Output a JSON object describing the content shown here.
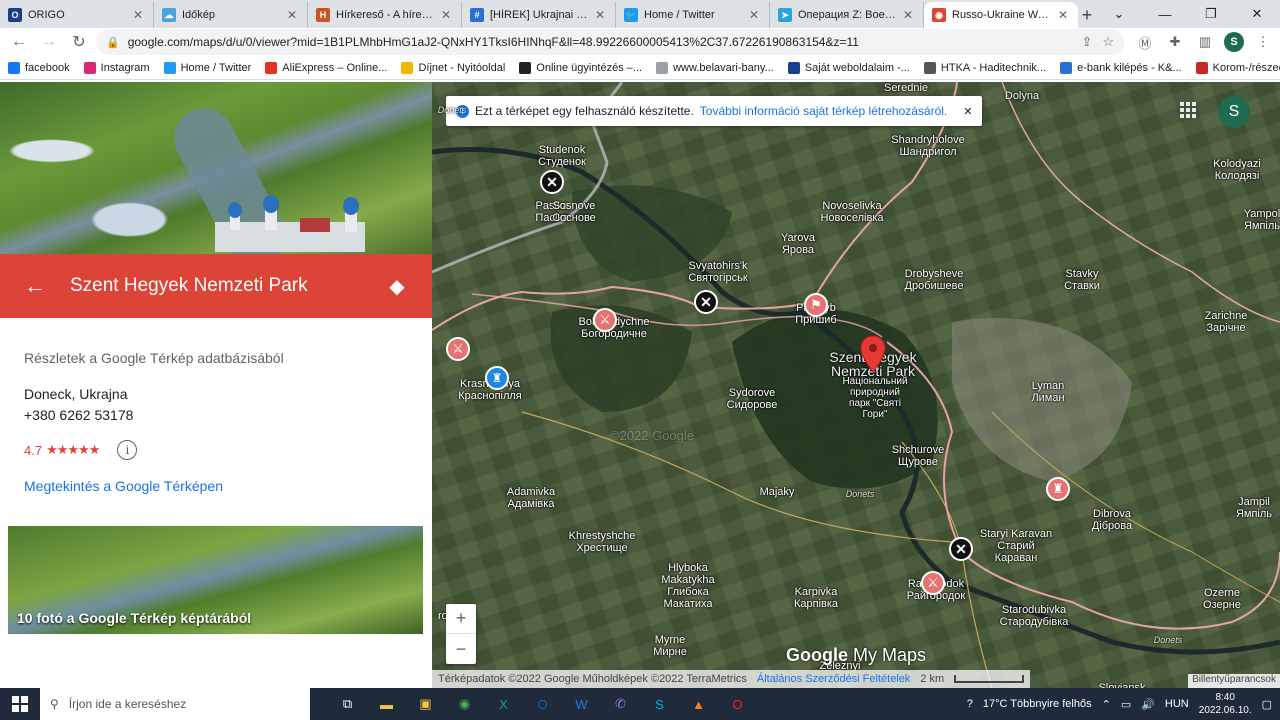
{
  "tabs": [
    {
      "title": "ORIGO",
      "color": "#1a3f8f",
      "glyph": "O"
    },
    {
      "title": "Időkép",
      "color": "#4aa3df",
      "glyph": "☁"
    },
    {
      "title": "Hírkereső - A hírek itt k",
      "color": "#c9541d",
      "glyph": "H"
    },
    {
      "title": "[HÍREK] Ukrajnai fegyve",
      "color": "#2a6fd1",
      "glyph": "#"
    },
    {
      "title": "Home / Twitter",
      "color": "#1d9bf0",
      "glyph": "🐦"
    },
    {
      "title": "Операция Z: Военкорр",
      "color": "#2aa3de",
      "glyph": "➤"
    },
    {
      "title": "Russo-Ukraine War – G",
      "color": "#db4437",
      "glyph": "◉",
      "active": true
    }
  ],
  "address": {
    "url": "google.com/maps/d/u/0/viewer?mid=1B1PLMhbHmG1aJ2-QNxHY1TksI6HINhqF&ll=48.99226600005413%2C37.67226190863154&z=11",
    "profile_letter": "S"
  },
  "bookmarks": [
    {
      "label": "facebook",
      "color": "#1877f2"
    },
    {
      "label": "Instagram",
      "color": "#d62976"
    },
    {
      "label": "Home / Twitter",
      "color": "#1d9bf0"
    },
    {
      "label": "AliExpress – Online...",
      "color": "#e43225"
    },
    {
      "label": "Díjnet - Nyitóoldal",
      "color": "#f2b600"
    },
    {
      "label": "Online ügyintézés –...",
      "color": "#222222"
    },
    {
      "label": "www.belavari-bany...",
      "color": "#9aa0a6"
    },
    {
      "label": "Saját weboldalaim -...",
      "color": "#1a3f8f"
    },
    {
      "label": "HTKA - Haditechnik...",
      "color": "#555555"
    },
    {
      "label": "e-bank kilépés - K&...",
      "color": "#2a6fd1"
    },
    {
      "label": "Korom-/részecskes...",
      "color": "#c62828"
    }
  ],
  "place": {
    "name": "Szent Hegyek Nemzeti Park",
    "source": "Részletek a Google Térkép adatbázisából",
    "address_line": "Doneck, Ukrajna",
    "phone": "+380 6262 53178",
    "rating": "4.7",
    "rating_value": 4.7,
    "stars": "★★★★★",
    "view_link": "Megtekintés a Google Térképen",
    "photos_caption": "10 fotó a Google Térkép képtárából"
  },
  "map": {
    "banner_text": "Ezt a térképet egy felhasználó készítette.",
    "banner_link": "További információ saját térkép létrehozásáról.",
    "avatar_letter": "S",
    "zoom_in": "+",
    "zoom_out": "−",
    "brand": "Google",
    "brand_suffix": "My Maps",
    "attribution": "Térképadatok ©2022 Google Műholdképek ©2022 TerraMetrics",
    "terms": "Általános Szerződési Feltételek",
    "scale": "2 km",
    "keyboard": "Billentyűparancsok",
    "labels": [
      {
        "id": "dolyna",
        "text": "Dolyna"
      },
      {
        "id": "serednie",
        "text": "Serednie"
      },
      {
        "id": "studenok",
        "text": "Studenok\nСтуденок"
      },
      {
        "id": "pasika",
        "text": "Pasika\nПасіка"
      },
      {
        "id": "shandryholove",
        "text": "Shandryholove\nШандригол"
      },
      {
        "id": "kolodyazi",
        "text": "Kolodyazi\nКолодязі"
      },
      {
        "id": "sosnove",
        "text": "Sosnove\nСоснове"
      },
      {
        "id": "novoselivka",
        "text": "Novoselivka\nНовоселівка"
      },
      {
        "id": "yarova",
        "text": "Yarova\nЯрова"
      },
      {
        "id": "yampil_top",
        "text": "Yampol\nЯмпіль"
      },
      {
        "id": "svyatohirsk",
        "text": "Svyatohirs'k\nСвятогірськ"
      },
      {
        "id": "drobysheve",
        "text": "Drobysheve\nДробишеве"
      },
      {
        "id": "stavky",
        "text": "Stavky\nСтавки"
      },
      {
        "id": "bohorodychne",
        "text": "Bohorodychne\nБогородичне"
      },
      {
        "id": "pryshyb",
        "text": "Pryshyb\nПришиб"
      },
      {
        "id": "zarichne",
        "text": "Zarichne\nЗарічне"
      },
      {
        "id": "krasnopillia",
        "text": "Krasnopillya\nКраснопілля"
      },
      {
        "id": "sydorove",
        "text": "Sydorove\nСидорове"
      },
      {
        "id": "nationalpark",
        "text": "Szent Hegyek\nNemzeti Park"
      },
      {
        "id": "parkua",
        "text": "Національний\nприродний\nпарк \"Святі\nГори\""
      },
      {
        "id": "lyman",
        "text": "Lyman\nЛиман"
      },
      {
        "id": "shchurove",
        "text": "Shchurove\nЩурове"
      },
      {
        "id": "majaky",
        "text": "Majaky"
      },
      {
        "id": "adamivka",
        "text": "Adamivka\nАдамівка"
      },
      {
        "id": "yampil",
        "text": "Jampil\nЯмпіль"
      },
      {
        "id": "kreshchenske",
        "text": "Khrestyshche\nХрестище"
      },
      {
        "id": "staryikaravan",
        "text": "Staryi Karavan\nСтарий\nКараван"
      },
      {
        "id": "dibrova",
        "text": "Dibrova\nДіброва"
      },
      {
        "id": "hlyboka",
        "text": "Hlyboka\nMakatykha\nГлибока\nМакатиха"
      },
      {
        "id": "karpivka",
        "text": "Karpivka\nКарпівка"
      },
      {
        "id": "raihorodok",
        "text": "Raihorodok\nРайгородок"
      },
      {
        "id": "ozerne",
        "text": "Ozerne\nОзерне"
      },
      {
        "id": "starodubivka",
        "text": "Starodubivka\nСтародубівка"
      },
      {
        "id": "myrne",
        "text": "Myrne\nМирне"
      },
      {
        "id": "donets1",
        "text": "Donets"
      },
      {
        "id": "donets2",
        "text": "Donets"
      },
      {
        "id": "donets3",
        "text": "Donets"
      },
      {
        "id": "sloviansk",
        "text": "Sloviansk"
      },
      {
        "id": "rola",
        "text": "rola"
      },
      {
        "id": "zeleznyi",
        "text": "Zeleznyi"
      },
      {
        "id": "watermark",
        "text": "©2022 Google"
      }
    ]
  },
  "taskbar": {
    "search_placeholder": "Írjon ide a kereséshez",
    "weather": "17°C  Többnyire felhős",
    "lang": "HUN",
    "time": "8:40",
    "date": "2022.06.10."
  }
}
